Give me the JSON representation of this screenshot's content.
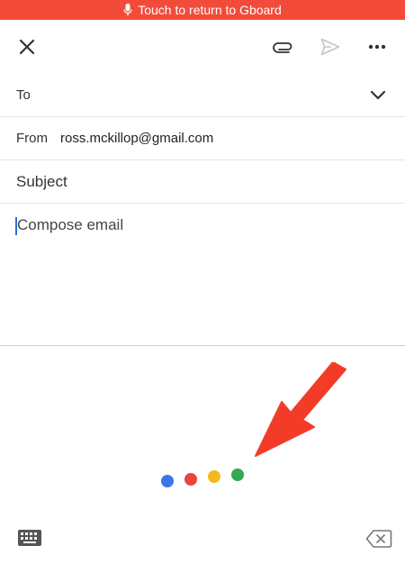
{
  "banner": {
    "text": "Touch to return to Gboard",
    "icon": "microphone-icon",
    "color": "#f24b3a"
  },
  "toolbar": {
    "icons": [
      "close-icon",
      "paperclip-icon",
      "send-icon",
      "more-horizontal-icon"
    ]
  },
  "compose": {
    "to_label": "To",
    "from_label": "From",
    "from_value": "ross.mckillop@gmail.com",
    "subject_placeholder": "Subject",
    "body_placeholder": "Compose email"
  },
  "voice": {
    "dot_colors": [
      "#3b78e7",
      "#e8453c",
      "#f6b91c",
      "#34a853"
    ],
    "annotation_arrow_color": "#f23c28"
  },
  "bottom": {
    "icons": [
      "keyboard-icon",
      "backspace-icon"
    ]
  }
}
